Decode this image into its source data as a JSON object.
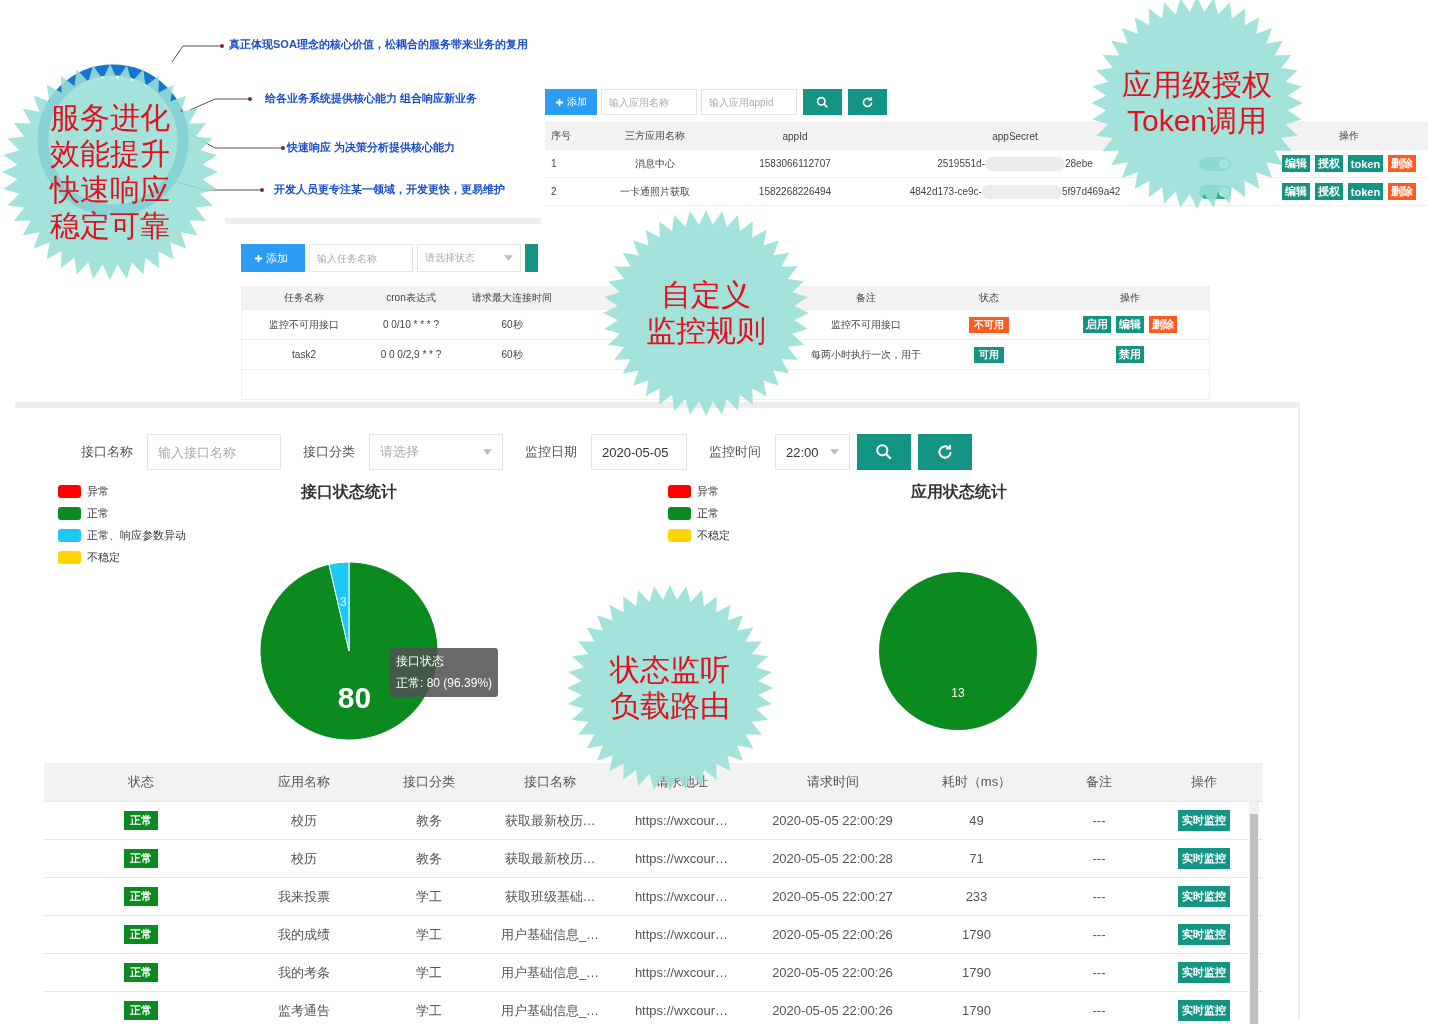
{
  "callouts": [
    "真正体现SOA理念的核心价值，松耦合的服务带来业务的复用",
    "给各业务系统提供核心能力 组合响应新业务",
    "快速响应 为决策分析提供核心能力",
    "开发人员更专注某一领域，开发更快，更易维护"
  ],
  "stamps": [
    {
      "lines": [
        "服务进化",
        "效能提升",
        "快速响应",
        "稳定可靠"
      ]
    },
    {
      "lines": [
        "应用级授权",
        "Token调用"
      ]
    },
    {
      "lines": [
        "自定义",
        "监控规则"
      ]
    },
    {
      "lines": [
        "状态监听",
        "负载路由"
      ]
    }
  ],
  "app_panel": {
    "add_button": "添加",
    "name_placeholder": "输入应用名称",
    "appid_placeholder": "输入应用appid",
    "header": {
      "no": "序号",
      "name": "三方应用名称",
      "appid": "appId",
      "secret": "appSecret",
      "actions": "操作"
    },
    "rows": [
      {
        "no": "1",
        "name": "消息中心",
        "appid": "1583066112707",
        "secret_start": "2519551d-",
        "secret_end": "28ebe",
        "on": true,
        "actions": [
          {
            "label": "编辑",
            "kind": "primary"
          },
          {
            "label": "授权",
            "kind": "primary"
          },
          {
            "label": "token",
            "kind": "primary"
          },
          {
            "label": "删除",
            "kind": "danger"
          }
        ]
      },
      {
        "no": "2",
        "name": "一卡通照片获取",
        "appid": "1582268226494",
        "secret_start": "4842d173-ce9c-",
        "secret_end": "5f97d469a42",
        "on": true,
        "actions": [
          {
            "label": "编辑",
            "kind": "primary"
          },
          {
            "label": "授权",
            "kind": "primary"
          },
          {
            "label": "token",
            "kind": "primary"
          },
          {
            "label": "删除",
            "kind": "danger"
          }
        ]
      }
    ]
  },
  "task_panel": {
    "add_button": "添加",
    "name_placeholder": "输入任务名称",
    "status_placeholder": "请选择状态",
    "header": {
      "name": "任务名称",
      "cron": "cron表达式",
      "max_conn": "请求最大连接时间",
      "remark": "备注",
      "status": "状态",
      "actions": "操作"
    },
    "rows": [
      {
        "name": "监控不可用接口",
        "cron": "0 0/10 * * * ?",
        "max_conn": "60秒",
        "remark": "监控不可用接口",
        "status": {
          "label": "不可用",
          "color": "#ff5a1f"
        },
        "actions": [
          {
            "label": "启用",
            "kind": "primary"
          },
          {
            "label": "编辑",
            "kind": "primary"
          },
          {
            "label": "删除",
            "kind": "danger"
          }
        ]
      },
      {
        "name": "task2",
        "cron": "0 0 0/2,9 * * ?",
        "max_conn": "60秒",
        "remark": "每两小时执行一次，用于",
        "status": {
          "label": "可用",
          "color": "#149482"
        },
        "actions": [
          {
            "label": "禁用",
            "kind": "primary"
          }
        ]
      }
    ]
  },
  "monitor": {
    "filters": [
      {
        "label": "接口名称",
        "kind": "input",
        "placeholder": "输入接口名称"
      },
      {
        "label": "接口分类",
        "kind": "select",
        "placeholder": "请选择"
      },
      {
        "label": "监控日期",
        "kind": "input",
        "value": "2020-05-05"
      },
      {
        "label": "监控时间",
        "kind": "select",
        "value": "22:00"
      }
    ],
    "charts": [
      {
        "slices": [
          {
            "color": "#ff0000"
          },
          {
            "color": "#0b8a1f"
          },
          {
            "color": "#1ec8f5"
          },
          {
            "color": "#ffd400"
          }
        ],
        "chart_data": {
          "type": "pie",
          "title": "接口状态统计",
          "categories": [
            "异常",
            "正常",
            "正常、响应参数异动",
            "不稳定"
          ],
          "values": [
            0,
            80,
            3,
            0
          ],
          "legend": "left",
          "data_labels": true
        },
        "tooltip": {
          "title": "接口状态",
          "text": "正常: 80 (96.39%)"
        }
      },
      {
        "slices": [
          {
            "color": "#ff0000"
          },
          {
            "color": "#0b8a1f"
          },
          {
            "color": "#ffd400"
          }
        ],
        "chart_data": {
          "type": "pie",
          "title": "应用状态统计",
          "categories": [
            "异常",
            "正常",
            "不稳定"
          ],
          "values": [
            0,
            13,
            0
          ],
          "legend": "left",
          "data_labels": true
        }
      }
    ],
    "columns": [
      "状态",
      "应用名称",
      "接口分类",
      "接口名称",
      "请求地址",
      "请求时间",
      "耗时（ms）",
      "备注",
      "操作"
    ],
    "rows": [
      {
        "status": {
          "label": "正常",
          "color": "#0b8a1f"
        },
        "app": "校历",
        "category": "教务",
        "api": "获取最新校历…",
        "url": "https://wxcour…",
        "time": "2020-05-05 22:00:29",
        "cost": "49",
        "remark": "---",
        "action": "实时监控"
      },
      {
        "status": {
          "label": "正常",
          "color": "#0b8a1f"
        },
        "app": "校历",
        "category": "教务",
        "api": "获取最新校历…",
        "url": "https://wxcour…",
        "time": "2020-05-05 22:00:28",
        "cost": "71",
        "remark": "---",
        "action": "实时监控"
      },
      {
        "status": {
          "label": "正常",
          "color": "#0b8a1f"
        },
        "app": "我来投票",
        "category": "学工",
        "api": "获取班级基础…",
        "url": "https://wxcour…",
        "time": "2020-05-05 22:00:27",
        "cost": "233",
        "remark": "---",
        "action": "实时监控"
      },
      {
        "status": {
          "label": "正常",
          "color": "#0b8a1f"
        },
        "app": "我的成绩",
        "category": "学工",
        "api": "用户基础信息_…",
        "url": "https://wxcour…",
        "time": "2020-05-05 22:00:26",
        "cost": "1790",
        "remark": "---",
        "action": "实时监控"
      },
      {
        "status": {
          "label": "正常",
          "color": "#0b8a1f"
        },
        "app": "我的考条",
        "category": "学工",
        "api": "用户基础信息_…",
        "url": "https://wxcour…",
        "time": "2020-05-05 22:00:26",
        "cost": "1790",
        "remark": "---",
        "action": "实时监控"
      },
      {
        "status": {
          "label": "正常",
          "color": "#0b8a1f"
        },
        "app": "监考通告",
        "category": "学工",
        "api": "用户基础信息_…",
        "url": "https://wxcour…",
        "time": "2020-05-05 22:00:26",
        "cost": "1790",
        "remark": "---",
        "action": "实时监控"
      }
    ]
  }
}
